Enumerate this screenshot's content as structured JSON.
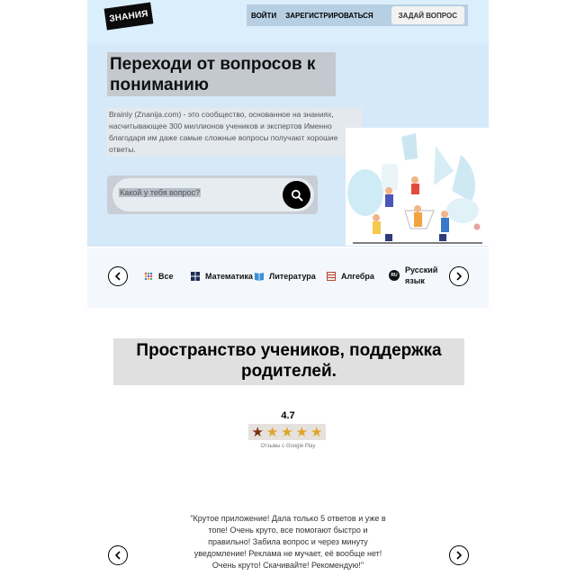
{
  "header": {
    "logo_text": "ЗНАНИЯ",
    "nav": {
      "login": "ВОЙТИ",
      "register": "ЗАРЕГИСТРИРОВАТЬСЯ",
      "ask": "ЗАДАЙ ВОПРОС"
    }
  },
  "hero": {
    "title": "Переходи от вопросов к пониманию",
    "description": "Brainly (Znanija.com) - это сообщество, основанное на знаниях, насчитывающее 300 миллионов учеников и экспертов Именно благодаря им даже самые сложные вопросы получают хорошие ответы.",
    "search_placeholder": "Какой у тебя вопрос?"
  },
  "categories": [
    {
      "label": "Все",
      "icon": "grid-icon"
    },
    {
      "label": "Математика",
      "icon": "math-icon"
    },
    {
      "label": "Литература",
      "icon": "book-icon"
    },
    {
      "label": "Алгебра",
      "icon": "abacus-icon"
    },
    {
      "label": "Русский язык",
      "icon": "language-icon",
      "badge": "RU"
    }
  ],
  "community": {
    "title": "Пространство учеников, поддержка родителей.",
    "rating": "4.7",
    "stars": 4.7,
    "rating_source": "Отзывы с Google Play"
  },
  "review": {
    "text": "\"Крутое приложение! Дала только 5 ответов и уже в топе! Очень круто, все помогают быстро и правильно! Забила вопрос и через минуту уведомление! Реклама не мучает, её вообще нет! Очень круто! Скачивайте! Рекомендую!\""
  },
  "colors": {
    "hero_bg": "#d6e9f9",
    "accent_dark": "#000000",
    "star": "#e0a526"
  }
}
